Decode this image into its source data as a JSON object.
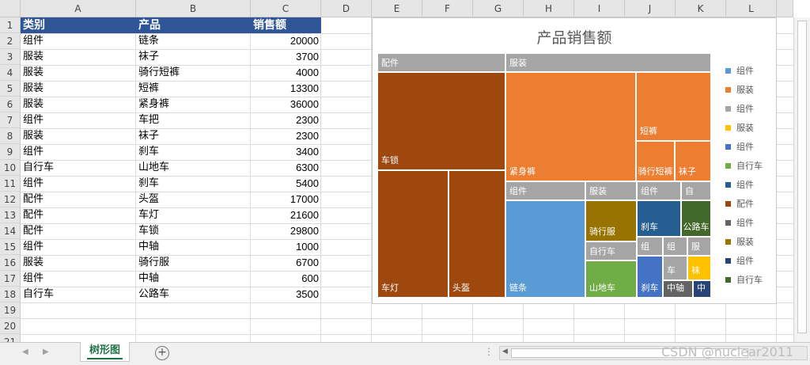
{
  "columns": [
    "A",
    "B",
    "C",
    "D",
    "E",
    "F",
    "G",
    "H",
    "I",
    "J",
    "K",
    "L"
  ],
  "rows": [
    "1",
    "2",
    "3",
    "4",
    "5",
    "6",
    "7",
    "8",
    "9",
    "10",
    "11",
    "12",
    "13",
    "14",
    "15",
    "16",
    "17",
    "18",
    "19",
    "20",
    "21"
  ],
  "table": {
    "headers": [
      "类别",
      "产品",
      "销售额"
    ],
    "rows": [
      [
        "组件",
        "链条",
        "20000"
      ],
      [
        "服装",
        "袜子",
        "3700"
      ],
      [
        "服装",
        "骑行短裤",
        "4000"
      ],
      [
        "服装",
        "短裤",
        "13300"
      ],
      [
        "服装",
        "紧身裤",
        "36000"
      ],
      [
        "组件",
        "车把",
        "2300"
      ],
      [
        "服装",
        "袜子",
        "2300"
      ],
      [
        "组件",
        "刹车",
        "3400"
      ],
      [
        "自行车",
        "山地车",
        "6300"
      ],
      [
        "组件",
        "刹车",
        "5400"
      ],
      [
        "配件",
        "头盔",
        "17000"
      ],
      [
        "配件",
        "车灯",
        "21600"
      ],
      [
        "配件",
        "车锁",
        "29800"
      ],
      [
        "组件",
        "中轴",
        "1000"
      ],
      [
        "服装",
        "骑行服",
        "6700"
      ],
      [
        "组件",
        "中轴",
        "600"
      ],
      [
        "自行车",
        "公路车",
        "3500"
      ]
    ]
  },
  "chart": {
    "title": "产品销售额",
    "groups": {
      "peijian": "配件",
      "fuzhuang": "服装",
      "zujian1": "组件",
      "fuzhuang2": "服装",
      "zujian2": "组件",
      "zixingche": "自"
    },
    "leaves": {
      "chesuo": "车锁",
      "chedeng": "车灯",
      "toukui": "头盔",
      "jinshenku": "紧身裤",
      "duanku": "短裤",
      "qixingduanku": "骑行短裤",
      "wazi": "袜子",
      "lianta": "链条",
      "qixingfu": "骑行服",
      "zixingche_hdr": "自行车",
      "shandiche": "山地车",
      "shache1": "刹车",
      "gongluche": "公路车",
      "zu_a": "组",
      "zu_b": "组",
      "fu_small": "服",
      "shache2": "刹车",
      "che": "车",
      "wa": "袜",
      "zhongzhou": "中轴",
      "zhong": "中"
    },
    "legend": [
      {
        "label": "组件",
        "color": "#5b9bd5"
      },
      {
        "label": "服装",
        "color": "#ed7d31"
      },
      {
        "label": "组件",
        "color": "#a5a5a5"
      },
      {
        "label": "服装",
        "color": "#ffc000"
      },
      {
        "label": "组件",
        "color": "#4472c4"
      },
      {
        "label": "自行车",
        "color": "#70ad47"
      },
      {
        "label": "组件",
        "color": "#255e91"
      },
      {
        "label": "配件",
        "color": "#9e480e"
      },
      {
        "label": "组件",
        "color": "#636363"
      },
      {
        "label": "服装",
        "color": "#997300"
      },
      {
        "label": "组件",
        "color": "#264478"
      },
      {
        "label": "自行车",
        "color": "#43682b"
      }
    ]
  },
  "sheet_tab": "树形图",
  "add_sheet": "+",
  "nav_prev": "◀",
  "nav_next": "▶",
  "dots": "⋮",
  "scroll_left": "◀",
  "scroll_right": "▶",
  "watermark": "CSDN @nuclear2011"
}
